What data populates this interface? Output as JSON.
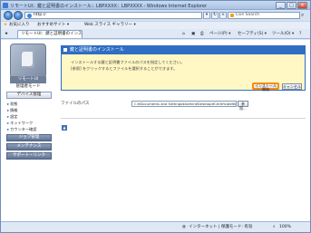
{
  "window": {
    "title": "リモートUI：鍵と証明書のインストール：LBPXXXX：LBPXXXX - Windows Internet Explorer"
  },
  "addressbar": {
    "url": "http://",
    "search_placeholder": "Live Search"
  },
  "favorites": {
    "favorites_label": "お気に入り",
    "suggested_sites": "おすすめサイト ▾",
    "web_slice": "Web スライス ギャラリー ▾"
  },
  "tabs": {
    "active_tab": "リモートUI：鍵と証明書のインストール：LB...",
    "page_menu": "ページ(P) ▾",
    "safety_menu": "セーフティ(S) ▾",
    "tools_menu": "ツール(O) ▾",
    "help_icon_label": "?"
  },
  "sidebar": {
    "logo_label": "リモートUI",
    "mode_label": "管理者モード",
    "menu_head": "デバイス管理",
    "items": [
      "状態",
      "情報",
      "設定",
      "ネットワーク",
      "カウンター確認"
    ],
    "buttons": [
      "ジョブ管理",
      "メンテナンス",
      "サポート・リンク"
    ]
  },
  "dialog": {
    "title": "鍵と証明書のインストール",
    "message_line1": "インストールする鍵と証明書ファイルのパスを指定してください。",
    "message_line2": "[参照] をクリックするとファイルを選択することができます。",
    "install_button": "インストール開始",
    "cancel_button": "キャンセル"
  },
  "file": {
    "label": "ファイルのパス",
    "value": "C:¥Documents and Settings¥Admin¥Desktop¥Certificate¥key.p12",
    "browse_button": "参照..."
  },
  "statusbar": {
    "zone": "インターネット | 保護モード: 有効",
    "zoom": "100%"
  },
  "colors": {
    "accent": "#2f6ec3",
    "dialog_bg": "#fff7c4",
    "highlight": "#ff8a00"
  }
}
